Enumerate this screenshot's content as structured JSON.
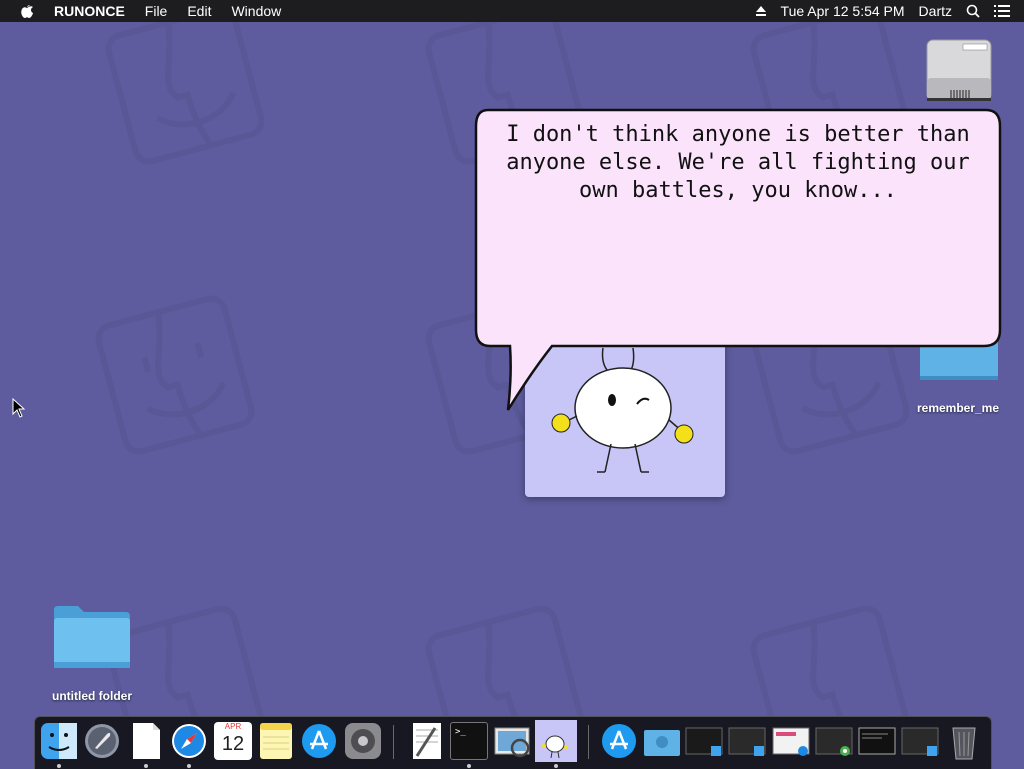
{
  "menubar": {
    "apple_icon": "apple-icon",
    "app_name": "RUNONCE",
    "menus": [
      "File",
      "Edit",
      "Window"
    ],
    "clock": "Tue Apr 12  5:54 PM",
    "user": "Dartz",
    "status_icons": [
      "eject-icon",
      "search-icon",
      "list-icon"
    ]
  },
  "desktop": {
    "icons": [
      {
        "label": "",
        "icon": "hard-drive-icon"
      },
      {
        "label": "remember_me",
        "icon": "folder-icon"
      },
      {
        "label": "untitled folder",
        "icon": "folder-icon"
      }
    ]
  },
  "speech_bubble": {
    "text": "I don't think anyone is better than anyone else. We're all fighting our own battles, you know..."
  },
  "dock": {
    "apps": [
      {
        "name": "finder",
        "icon": "finder-icon",
        "running": true
      },
      {
        "name": "launchpad",
        "icon": "rocket-icon",
        "running": false
      },
      {
        "name": "document",
        "icon": "document-icon",
        "running": true
      },
      {
        "name": "safari",
        "icon": "compass-icon",
        "running": true
      },
      {
        "name": "calendar",
        "icon": "calendar-icon",
        "running": false,
        "month": "APR",
        "day": "12"
      },
      {
        "name": "notes",
        "icon": "notes-icon",
        "running": false
      },
      {
        "name": "app store",
        "icon": "app-store-icon",
        "running": false
      },
      {
        "name": "system preferences",
        "icon": "gear-icon",
        "running": false
      },
      {
        "name": "textedit",
        "icon": "pen-paper-icon",
        "running": false
      },
      {
        "name": "terminal",
        "icon": "terminal-icon",
        "running": true
      },
      {
        "name": "preview",
        "icon": "preview-icon",
        "running": false
      },
      {
        "name": "runonce",
        "icon": "bunny-icon",
        "running": true
      }
    ],
    "stack": [
      {
        "name": "applications",
        "icon": "app-store-icon"
      },
      {
        "name": "downloads",
        "icon": "folder-icon"
      },
      {
        "name": "window-1",
        "icon": "window-thumbnail-icon"
      },
      {
        "name": "window-2",
        "icon": "window-thumbnail-icon"
      },
      {
        "name": "window-3",
        "icon": "window-thumbnail-icon"
      },
      {
        "name": "window-4",
        "icon": "window-thumbnail-icon"
      },
      {
        "name": "window-5",
        "icon": "window-thumbnail-icon"
      },
      {
        "name": "window-6",
        "icon": "window-thumbnail-icon"
      },
      {
        "name": "trash",
        "icon": "trash-icon"
      }
    ],
    "terminal_prompt": ">_"
  },
  "colors": {
    "wallpaper": "#5e5c9e",
    "menubar": "#1d1d1f",
    "bubble_fill": "#fbe3fb",
    "character_window": "#c8c6f6",
    "folder": "#5fb2e6",
    "bunny_hands": "#f3e01a"
  }
}
